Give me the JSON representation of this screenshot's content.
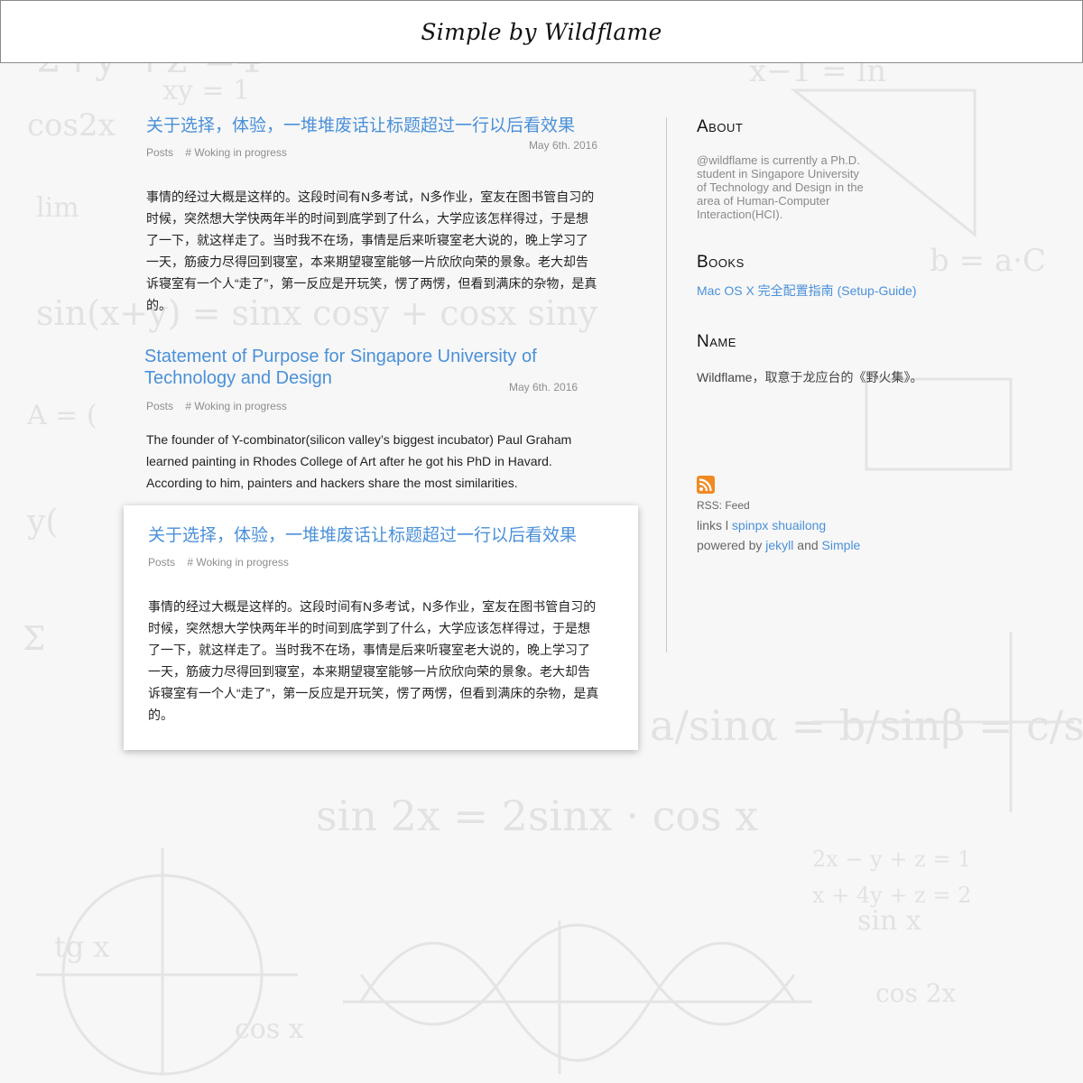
{
  "header": {
    "title": "Simple by Wildflame"
  },
  "posts": [
    {
      "title": "关于选择，体验，一堆堆废话让标题超过一行以后看效果",
      "category": "Posts",
      "tag": "# Woking in progress",
      "date": "May 6th. 2016",
      "excerpt": "事情的经过大概是这样的。这段时间有N多考试，N多作业，室友在图书管自习的时候，突然想大学快两年半的时间到底学到了什么，大学应该怎样得过，于是想了一下，就这样走了。当时我不在场，事情是后来听寝室老大说的，晚上学习了一天，筋疲力尽得回到寝室，本来期望寝室能够一片欣欣向荣的景象。老大却告诉寝室有一个人“走了”，第一反应是开玩笑，愣了两愣，但看到满床的杂物，是真的。"
    },
    {
      "title": "Statement of Purpose for Singapore University of Technology and Design",
      "category": "Posts",
      "tag": "# Woking in progress",
      "date": "May 6th. 2016",
      "excerpt": "The founder of Y-combinator(silicon valley’s biggest incubator) Paul Graham learned painting in Rhodes College of Art after he got his PhD in Havard. According to him, painters and hackers share the most similarities."
    },
    {
      "title": "关于选择，体验，一堆堆废话让标题超过一行以后看效果",
      "category": "Posts",
      "tag": "# Woking in progress",
      "excerpt": "事情的经过大概是这样的。这段时间有N多考试，N多作业，室友在图书管自习的时候，突然想大学快两年半的时间到底学到了什么，大学应该怎样得过，于是想了一下，就这样走了。当时我不在场，事情是后来听寝室老大说的，晚上学习了一天，筋疲力尽得回到寝室，本来期望寝室能够一片欣欣向荣的景象。老大却告诉寝室有一个人“走了”，第一反应是开玩笑，愣了两愣，但看到满床的杂物，是真的。"
    }
  ],
  "sidebar": {
    "about_heading": "About",
    "about_text": "@wildflame is currently a Ph.D. student in Singapore University of Technology and Design in the area of Human-Computer Interaction(HCI).",
    "books_heading": "Books",
    "book_link": "Mac OS X 完全配置指南 (Setup-Guide)",
    "name_heading": "Name",
    "name_text": "Wildflame，取意于龙应台的《野火集》。",
    "rss_text": "RSS: Feed",
    "links_prefix": "links l",
    "links": [
      "spinpx",
      "shuailong"
    ],
    "powered_prefix": "powered by",
    "powered_jekyll": "jekyll",
    "powered_and": "and",
    "powered_simple": "Simple",
    "rss_icon": "rss-icon",
    "rss_color": "#f08a24"
  },
  "colors": {
    "link": "#4a90d9",
    "meta": "#8e8e8e",
    "background": "#f7f7f7"
  }
}
